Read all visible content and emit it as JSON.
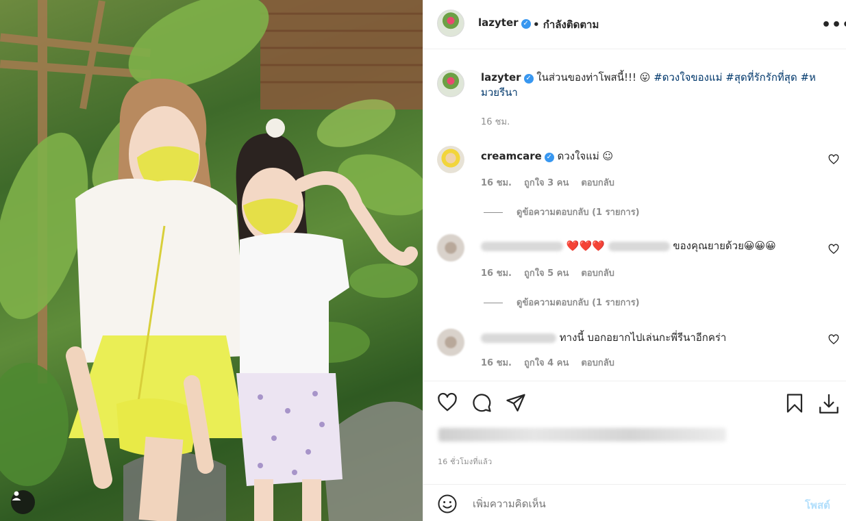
{
  "post": {
    "username": "lazyter",
    "follow_status": "• กำลังติดตาม",
    "more_icon": "more-horizontal-icon"
  },
  "caption": {
    "username": "lazyter",
    "text": "ในส่วนของท่าโพสนี้!!! 😛",
    "hashtags_line1": "#ดวงใจของแม่ #สุดที่รักรักที่สุด #ห",
    "hashtags_line2": "มวยรีนา",
    "time": "16 ชม."
  },
  "comments": [
    {
      "username": "creamcare",
      "verified": true,
      "text": "ดวงใจแม่ ☺",
      "time": "16 ชม.",
      "likes": "ถูกใจ 3 คน",
      "reply": "ตอบกลับ",
      "view_replies": "ดูข้อความตอบกลับ (1 รายการ)"
    },
    {
      "hearts": "❤️❤️❤️",
      "text": "ของคุณยายด้วย😀😀😀",
      "time": "16 ชม.",
      "likes": "ถูกใจ 5 คน",
      "reply": "ตอบกลับ",
      "view_replies": "ดูข้อความตอบกลับ (1 รายการ)"
    },
    {
      "text": "ทางนี้ บอกอยากไปเล่นกะพี่รีนาอีกคร่า",
      "time": "16 ชม.",
      "likes": "ถูกใจ 4 คน",
      "reply": "ตอบกลับ"
    }
  ],
  "footer": {
    "time_ago": "16 ชั่วโมงที่แล้ว",
    "comment_placeholder": "เพิ่มความคิดเห็น",
    "post_label": "โพสต์"
  },
  "colors": {
    "link": "#00376b",
    "muted": "#8e8e8e",
    "verified": "#3897f0",
    "post_button": "#b2dffc"
  }
}
